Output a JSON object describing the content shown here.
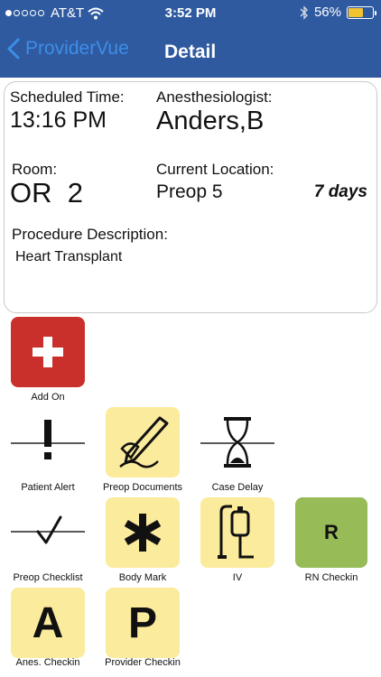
{
  "status_bar": {
    "carrier": "AT&T",
    "time": "3:52 PM",
    "battery": "56%",
    "battery_level": 0.56
  },
  "nav": {
    "back_label": "ProviderVue",
    "title": "Detail"
  },
  "detail": {
    "scheduled_time_label": "Scheduled Time:",
    "scheduled_time": "13:16 PM",
    "anesthesiologist_label": "Anesthesiologist:",
    "anesthesiologist": "Anders,B",
    "room_label": "Room:",
    "room": "OR  2",
    "current_location_label": "Current Location:",
    "current_location": "Preop 5",
    "duration": "7 days",
    "procedure_label": "Procedure Description:",
    "procedure": "Heart Transplant"
  },
  "actions": {
    "add_on": "Add On",
    "patient_alert": "Patient Alert",
    "preop_documents": "Preop Documents",
    "case_delay": "Case Delay",
    "preop_checklist": "Preop Checklist",
    "body_mark": "Body Mark",
    "iv": "IV",
    "rn_checkin": "RN Checkin",
    "rn_letter": "R",
    "anes_checkin": "Anes. Checkin",
    "anes_letter": "A",
    "provider_checkin": "Provider Checkin",
    "provider_letter": "P"
  },
  "colors": {
    "nav_bar": "#2f5aa0",
    "back_link": "#3d8ee8",
    "tile_yellow": "#fbeb9c",
    "tile_green": "#97bb56",
    "tile_red": "#c9302c",
    "battery_fill": "#f2c230"
  }
}
